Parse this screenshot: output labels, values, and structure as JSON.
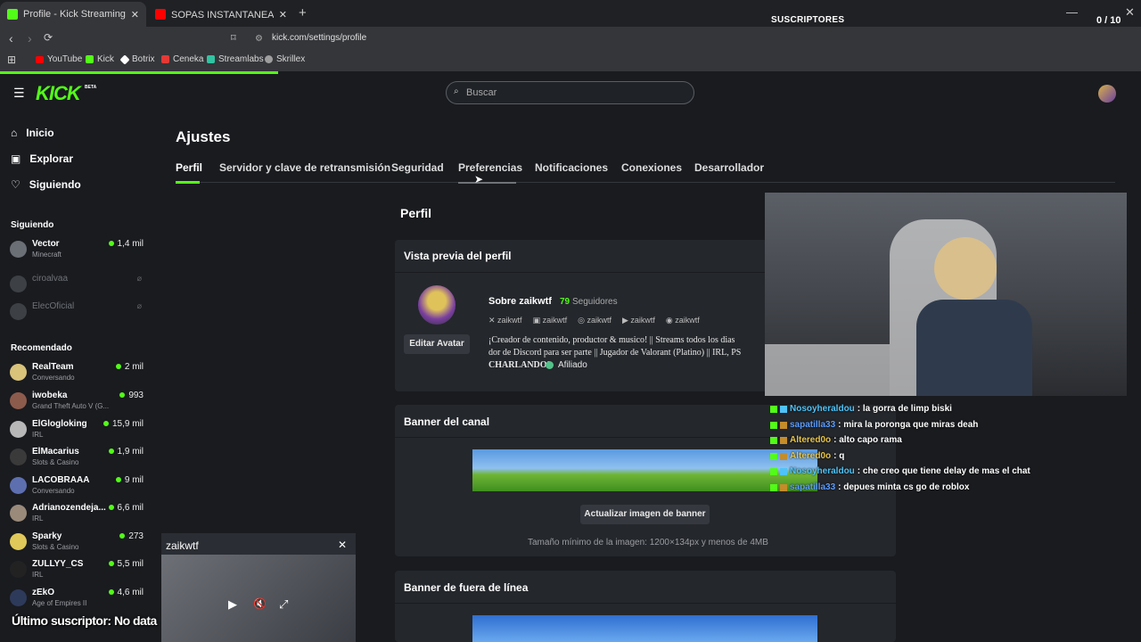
{
  "browser": {
    "tabs": [
      {
        "label": "Profile - Kick Streaming",
        "active": true
      },
      {
        "label": "SOPAS INSTANTANEAS PREMIUM 🩸",
        "active": false
      }
    ],
    "address": "kick.com/settings/profile",
    "bookmarks": [
      "YouTube",
      "Kick",
      "Botrix",
      "Ceneka",
      "Streamlabs",
      "Skrillex"
    ],
    "colors": {
      "youtube": "#ff0000",
      "kick": "#53fc18",
      "botrix": "#ffffff",
      "ceneka": "#e53935",
      "streamlabs": "#31c3a2",
      "skrillex": "#9e9e9e"
    }
  },
  "overlay_subs": {
    "label": "SUSCRIPTORES",
    "count": "0 / 10"
  },
  "site": {
    "logo": "KICK",
    "logo_badge": "BETA",
    "search_placeholder": "Buscar"
  },
  "sidebar": {
    "nav": [
      {
        "label": "Inicio",
        "icon": "home-icon"
      },
      {
        "label": "Explorar",
        "icon": "explore-icon"
      },
      {
        "label": "Siguiendo",
        "icon": "heart-icon"
      }
    ],
    "following_title": "Siguiendo",
    "following": [
      {
        "name": "Vector",
        "category": "Minecraft",
        "viewers": "1,4 mil",
        "online": true
      },
      {
        "name": "ciroalvaa",
        "category": "",
        "viewers": "",
        "online": false
      },
      {
        "name": "ElecOficial",
        "category": "",
        "viewers": "",
        "online": false
      }
    ],
    "recommended_title": "Recomendado",
    "recommended": [
      {
        "name": "RealTeam",
        "category": "Conversando",
        "viewers": "2 mil"
      },
      {
        "name": "iwobeka",
        "category": "Grand Theft Auto V (G...",
        "viewers": "993"
      },
      {
        "name": "ElGlogloking",
        "category": "IRL",
        "viewers": "15,9 mil"
      },
      {
        "name": "ElMacarius",
        "category": "Slots & Casino",
        "viewers": "1,9 mil"
      },
      {
        "name": "LACOBRAAA",
        "category": "Conversando",
        "viewers": "9 mil"
      },
      {
        "name": "Adrianozendeja...",
        "category": "IRL",
        "viewers": "6,6 mil"
      },
      {
        "name": "Sparky",
        "category": "Slots & Casino",
        "viewers": "273"
      },
      {
        "name": "ZULLYY_CS",
        "category": "IRL",
        "viewers": "5,5 mil"
      },
      {
        "name": "zEkO",
        "category": "Age of Empires II",
        "viewers": "4,6 mil"
      }
    ]
  },
  "settings": {
    "title": "Ajustes",
    "tabs": [
      "Perfil",
      "Servidor y clave de retransmisión",
      "Seguridad",
      "Preferencias",
      "Notificaciones",
      "Conexiones",
      "Desarrollador"
    ],
    "section_title": "Perfil",
    "preview": {
      "title": "Vista previa del perfil",
      "about": "Sobre zaikwtf",
      "followers_count": "79",
      "followers_label": "Seguidores",
      "socials": [
        "zaikwtf",
        "zaikwtf",
        "zaikwtf",
        "zaikwtf",
        "zaikwtf"
      ],
      "edit_avatar": "Editar Avatar",
      "bio_line1": "¡Creador de contenido, productor & musico! || Streams todos los dias",
      "bio_line2": "dor de Discord para ser parte || Jugador de Valorant (Platino) || IRL, PS",
      "bio_line3": "CHARLANDO!",
      "badge": "Afiliado"
    },
    "banner": {
      "title": "Banner del canal",
      "button": "Actualizar imagen de banner",
      "hint": "Tamaño mínimo de la imagen: 1200×134px y menos de 4MB"
    },
    "offline_banner": {
      "title": "Banner de fuera de línea"
    }
  },
  "chat": [
    {
      "user": "Nosoyheraldou",
      "msg": ": la gorra de limp biski",
      "color": "#4fc3f7"
    },
    {
      "user": "sapatilla33",
      "msg": ": mira la poronga que miras deah",
      "color": "#5c9dff"
    },
    {
      "user": "Altered0o",
      "msg": ": alto capo rama",
      "color": "#e8c547"
    },
    {
      "user": "Altered0o",
      "msg": ": q",
      "color": "#e8c547"
    },
    {
      "user": "Nosoyheraldou",
      "msg": ": che creo que tiene delay de mas el chat",
      "color": "#4fc3f7"
    },
    {
      "user": "sapatilla33",
      "msg": ": depues minta cs go de roblox",
      "color": "#5c9dff"
    }
  ],
  "mini_player": {
    "title": "zaikwtf"
  },
  "last_sub": "Último suscriptor: No data"
}
